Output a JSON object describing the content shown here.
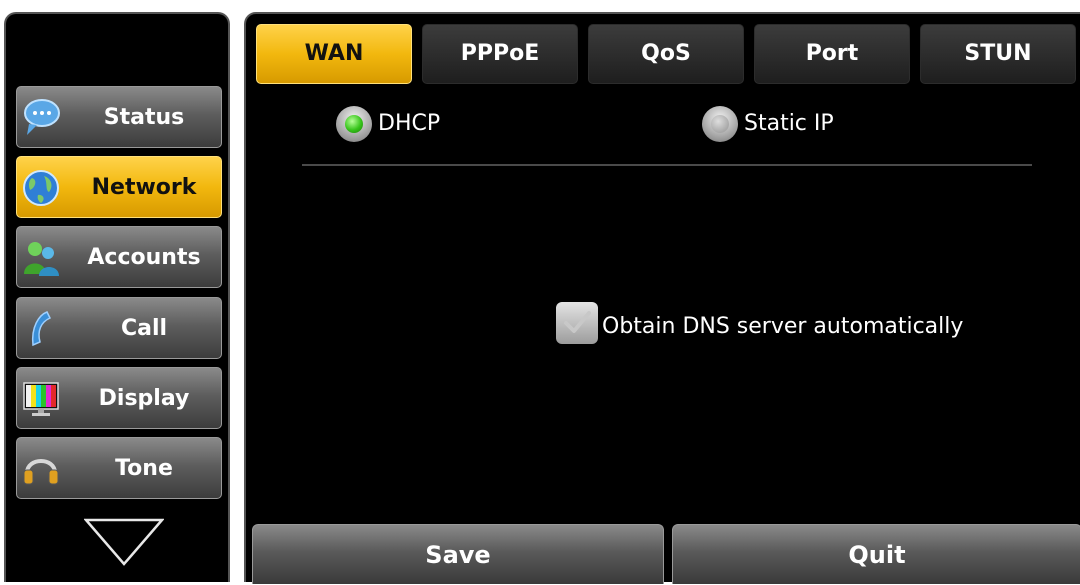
{
  "sidebar": {
    "items": [
      {
        "label": "Status",
        "icon": "speech-bubble-icon",
        "active": false
      },
      {
        "label": "Network",
        "icon": "globe-icon",
        "active": true
      },
      {
        "label": "Accounts",
        "icon": "users-icon",
        "active": false
      },
      {
        "label": "Call",
        "icon": "phone-handset-icon",
        "active": false
      },
      {
        "label": "Display",
        "icon": "color-bars-monitor-icon",
        "active": false
      },
      {
        "label": "Tone",
        "icon": "headphones-icon",
        "active": false
      }
    ],
    "scroll_icon": "chevron-down-icon"
  },
  "tabs": [
    {
      "label": "WAN",
      "active": true
    },
    {
      "label": "PPPoE",
      "active": false
    },
    {
      "label": "QoS",
      "active": false
    },
    {
      "label": "Port",
      "active": false
    },
    {
      "label": "STUN",
      "active": false
    }
  ],
  "wan": {
    "mode_options": [
      {
        "label": "DHCP",
        "selected": true
      },
      {
        "label": "Static IP",
        "selected": false
      }
    ],
    "dns_auto": {
      "label": "Obtain DNS server automatically",
      "checked": true
    }
  },
  "footer": {
    "save_label": "Save",
    "quit_label": "Quit"
  },
  "colors": {
    "accent": "#f2b80e",
    "background": "#000000",
    "radio_on": "#36c41a"
  }
}
